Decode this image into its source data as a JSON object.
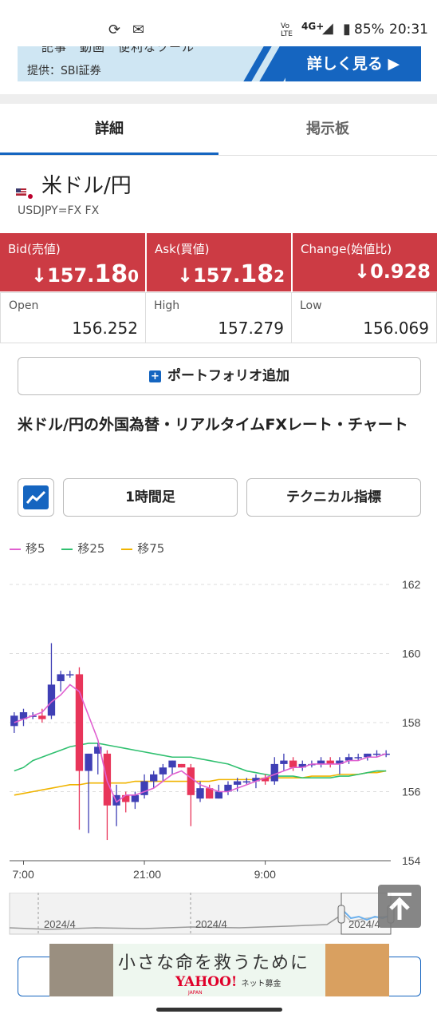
{
  "status_bar": {
    "battery": "85%",
    "time": "20:31",
    "network": "4G+",
    "volte": "Vo LTE"
  },
  "promo_banner": {
    "source": "提供：SBI証券",
    "cut_text": "記事　動画　便利なツール",
    "more_label": "詳しく見る ▶"
  },
  "tabs": [
    {
      "label": "詳細",
      "active": true
    },
    {
      "label": "掲示板",
      "active": false
    }
  ],
  "pair": {
    "title": "米ドル/円",
    "code": "USDJPY=FX FX"
  },
  "quotes": {
    "bid": {
      "label": "Bid(売値)",
      "arrow": "↓",
      "prefix": "157.",
      "big": "18",
      "suffix": "0"
    },
    "ask": {
      "label": "Ask(買値)",
      "arrow": "↓",
      "prefix": "157.",
      "big": "18",
      "suffix": "2"
    },
    "change": {
      "label": "Change(始値比)",
      "arrow": "↓",
      "value": "0.928"
    }
  },
  "stats": {
    "open": {
      "label": "Open",
      "value": "156.252"
    },
    "high": {
      "label": "High",
      "value": "157.279"
    },
    "low": {
      "label": "Low",
      "value": "156.069"
    }
  },
  "portfolio_button": "ポートフォリオ追加",
  "section_title": "米ドル/円の外国為替・リアルタイムFXレート・チャート",
  "chart_controls": {
    "interval": "1時間足",
    "technical": "テクニカル指標"
  },
  "colors": {
    "quote_red": "#cc3b44",
    "accent_blue": "#1565c0",
    "up_candle": "#3f3fb5",
    "down_candle": "#e8355a",
    "ma5": "#e060d0",
    "ma25": "#30c070",
    "ma75": "#f0b400"
  },
  "chart_data": {
    "type": "candlestick",
    "legend": [
      {
        "name": "移5",
        "color": "#e060d0"
      },
      {
        "name": "移25",
        "color": "#30c070"
      },
      {
        "name": "移75",
        "color": "#f0b400"
      }
    ],
    "y_ticks": [
      "162",
      "160",
      "158",
      "156",
      "154"
    ],
    "ylim": [
      154,
      162
    ],
    "x_ticks": [
      "7:00",
      "21:00",
      "9:00"
    ],
    "candles": [
      {
        "o": 157.9,
        "h": 158.3,
        "l": 157.7,
        "c": 158.2
      },
      {
        "o": 158.1,
        "h": 158.4,
        "l": 157.9,
        "c": 158.3
      },
      {
        "o": 158.2,
        "h": 158.3,
        "l": 158.1,
        "c": 158.2
      },
      {
        "o": 158.2,
        "h": 158.4,
        "l": 158.0,
        "c": 158.1
      },
      {
        "o": 158.2,
        "h": 160.3,
        "l": 158.1,
        "c": 159.1
      },
      {
        "o": 159.2,
        "h": 159.5,
        "l": 158.9,
        "c": 159.4
      },
      {
        "o": 159.4,
        "h": 159.5,
        "l": 159.3,
        "c": 159.4
      },
      {
        "o": 159.4,
        "h": 159.6,
        "l": 154.9,
        "c": 156.6
      },
      {
        "o": 156.6,
        "h": 157.1,
        "l": 154.8,
        "c": 157.1
      },
      {
        "o": 157.1,
        "h": 157.4,
        "l": 156.5,
        "c": 157.3
      },
      {
        "o": 157.1,
        "h": 157.2,
        "l": 154.6,
        "c": 155.6
      },
      {
        "o": 155.6,
        "h": 156.2,
        "l": 155.0,
        "c": 155.9
      },
      {
        "o": 155.9,
        "h": 156.0,
        "l": 155.4,
        "c": 155.7
      },
      {
        "o": 155.7,
        "h": 156.0,
        "l": 155.5,
        "c": 155.9
      },
      {
        "o": 155.9,
        "h": 156.5,
        "l": 155.8,
        "c": 156.3
      },
      {
        "o": 156.3,
        "h": 156.6,
        "l": 156.1,
        "c": 156.5
      },
      {
        "o": 156.5,
        "h": 156.8,
        "l": 156.3,
        "c": 156.7
      },
      {
        "o": 156.7,
        "h": 156.9,
        "l": 156.5,
        "c": 156.9
      },
      {
        "o": 156.8,
        "h": 156.8,
        "l": 156.7,
        "c": 156.7
      },
      {
        "o": 156.7,
        "h": 156.8,
        "l": 155.0,
        "c": 155.9
      },
      {
        "o": 155.8,
        "h": 156.3,
        "l": 155.7,
        "c": 156.1
      },
      {
        "o": 156.1,
        "h": 156.2,
        "l": 155.8,
        "c": 155.8
      },
      {
        "o": 155.8,
        "h": 156.2,
        "l": 155.8,
        "c": 156.0
      },
      {
        "o": 156.0,
        "h": 156.3,
        "l": 155.9,
        "c": 156.2
      },
      {
        "o": 156.2,
        "h": 156.4,
        "l": 156.0,
        "c": 156.3
      },
      {
        "o": 156.3,
        "h": 156.4,
        "l": 156.2,
        "c": 156.3
      },
      {
        "o": 156.3,
        "h": 156.5,
        "l": 156.1,
        "c": 156.4
      },
      {
        "o": 156.4,
        "h": 156.5,
        "l": 156.2,
        "c": 156.3
      },
      {
        "o": 156.3,
        "h": 157.0,
        "l": 156.2,
        "c": 156.8
      },
      {
        "o": 156.8,
        "h": 157.1,
        "l": 156.6,
        "c": 156.9
      },
      {
        "o": 156.9,
        "h": 157.0,
        "l": 156.6,
        "c": 156.7
      },
      {
        "o": 156.7,
        "h": 156.9,
        "l": 156.6,
        "c": 156.8
      },
      {
        "o": 156.8,
        "h": 156.9,
        "l": 156.7,
        "c": 156.8
      },
      {
        "o": 156.8,
        "h": 157.0,
        "l": 156.7,
        "c": 156.9
      },
      {
        "o": 156.9,
        "h": 157.0,
        "l": 156.7,
        "c": 156.8
      },
      {
        "o": 156.8,
        "h": 157.0,
        "l": 156.5,
        "c": 156.9
      },
      {
        "o": 156.9,
        "h": 157.1,
        "l": 156.8,
        "c": 157.0
      },
      {
        "o": 157.0,
        "h": 157.1,
        "l": 156.9,
        "c": 157.0
      },
      {
        "o": 157.0,
        "h": 157.1,
        "l": 156.9,
        "c": 157.1
      },
      {
        "o": 157.1,
        "h": 157.2,
        "l": 157.0,
        "c": 157.1
      },
      {
        "o": 157.1,
        "h": 157.2,
        "l": 157.0,
        "c": 157.1
      }
    ],
    "ma5": [
      158.0,
      158.1,
      158.2,
      158.3,
      158.6,
      158.8,
      159.1,
      158.9,
      158.2,
      157.5,
      156.3,
      155.7,
      155.9,
      155.9,
      156.0,
      156.1,
      156.3,
      156.5,
      156.6,
      156.4,
      156.2,
      156.1,
      156.0,
      156.0,
      156.1,
      156.2,
      156.3,
      156.4,
      156.5,
      156.6,
      156.7,
      156.7,
      156.8,
      156.8,
      156.8,
      156.8,
      156.9,
      156.9,
      157.0,
      157.0,
      157.1
    ],
    "ma25": [
      156.6,
      156.7,
      156.9,
      157.0,
      157.1,
      157.2,
      157.3,
      157.35,
      157.4,
      157.4,
      157.35,
      157.3,
      157.25,
      157.2,
      157.15,
      157.1,
      157.05,
      157.0,
      157.0,
      157.0,
      156.95,
      156.9,
      156.85,
      156.8,
      156.7,
      156.6,
      156.55,
      156.5,
      156.45,
      156.45,
      156.45,
      156.4,
      156.4,
      156.4,
      156.4,
      156.45,
      156.45,
      156.5,
      156.55,
      156.6,
      156.6
    ],
    "ma75": [
      155.9,
      155.95,
      156.0,
      156.05,
      156.1,
      156.15,
      156.2,
      156.2,
      156.25,
      156.25,
      156.25,
      156.25,
      156.25,
      156.3,
      156.3,
      156.3,
      156.3,
      156.3,
      156.3,
      156.3,
      156.3,
      156.3,
      156.35,
      156.35,
      156.35,
      156.35,
      156.35,
      156.4,
      156.4,
      156.4,
      156.4,
      156.4,
      156.45,
      156.45,
      156.45,
      156.5,
      156.5,
      156.5,
      156.55,
      156.55,
      156.6
    ],
    "navigator": {
      "labels": [
        "2024/4",
        "2024/4",
        "2024/4"
      ]
    }
  },
  "bottom_ad": {
    "headline": "小さな命を救うために",
    "brand": "YAHOO!",
    "brand_sub": "ネット募金",
    "brand_region": "JAPAN"
  }
}
